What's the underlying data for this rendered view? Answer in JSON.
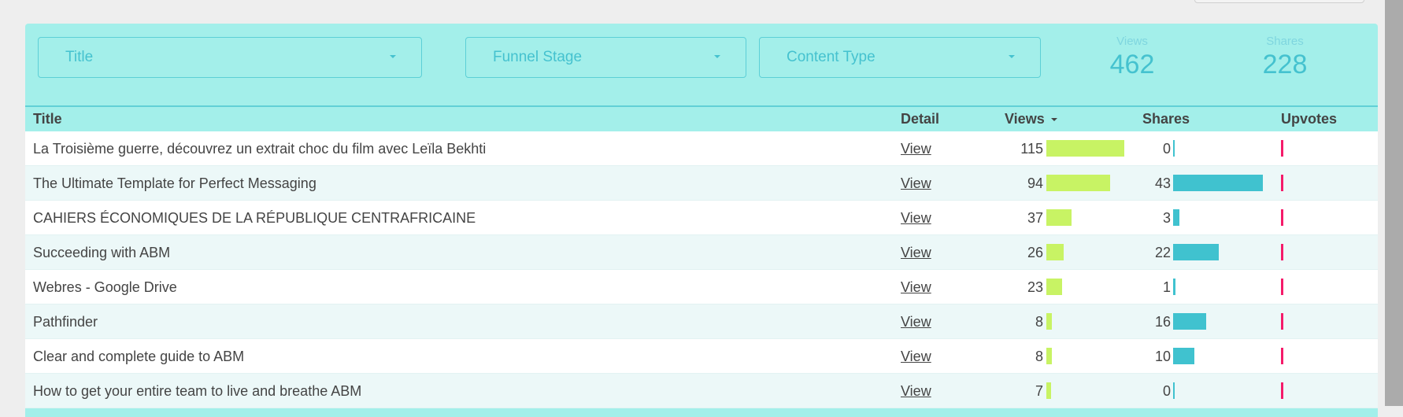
{
  "filters": [
    {
      "label": "Title"
    },
    {
      "label": "Funnel Stage"
    },
    {
      "label": "Content Type"
    }
  ],
  "kpis": {
    "views": {
      "label": "Views",
      "value": "462"
    },
    "shares": {
      "label": "Shares",
      "value": "228"
    }
  },
  "table": {
    "headers": {
      "title": "Title",
      "detail": "Detail",
      "views": "Views",
      "shares": "Shares",
      "upvotes": "Upvotes"
    },
    "sorted_by": "Views",
    "sort_direction": "descending",
    "colors": {
      "views_bar": "#c8f364",
      "shares_bar": "#40c2cf",
      "upvotes_bar": "#f51b6a"
    },
    "rows": [
      {
        "title": "La Troisième guerre, découvrez un extrait choc du film avec Leïla Bekhti",
        "detail": "View",
        "views": 115,
        "shares": 0
      },
      {
        "title": "The Ultimate Template for Perfect Messaging",
        "detail": "View",
        "views": 94,
        "shares": 43
      },
      {
        "title": "CAHIERS ÉCONOMIQUES DE LA RÉPUBLIQUE CENTRAFRICAINE",
        "detail": "View",
        "views": 37,
        "shares": 3
      },
      {
        "title": "Succeeding with ABM",
        "detail": "View",
        "views": 26,
        "shares": 22
      },
      {
        "title": "Webres - Google Drive",
        "detail": "View",
        "views": 23,
        "shares": 1
      },
      {
        "title": "Pathfinder",
        "detail": "View",
        "views": 8,
        "shares": 16
      },
      {
        "title": "Clear and complete guide to ABM",
        "detail": "View",
        "views": 8,
        "shares": 10
      },
      {
        "title": "How to get your entire team to live and breathe ABM",
        "detail": "View",
        "views": 7,
        "shares": 0
      }
    ]
  }
}
